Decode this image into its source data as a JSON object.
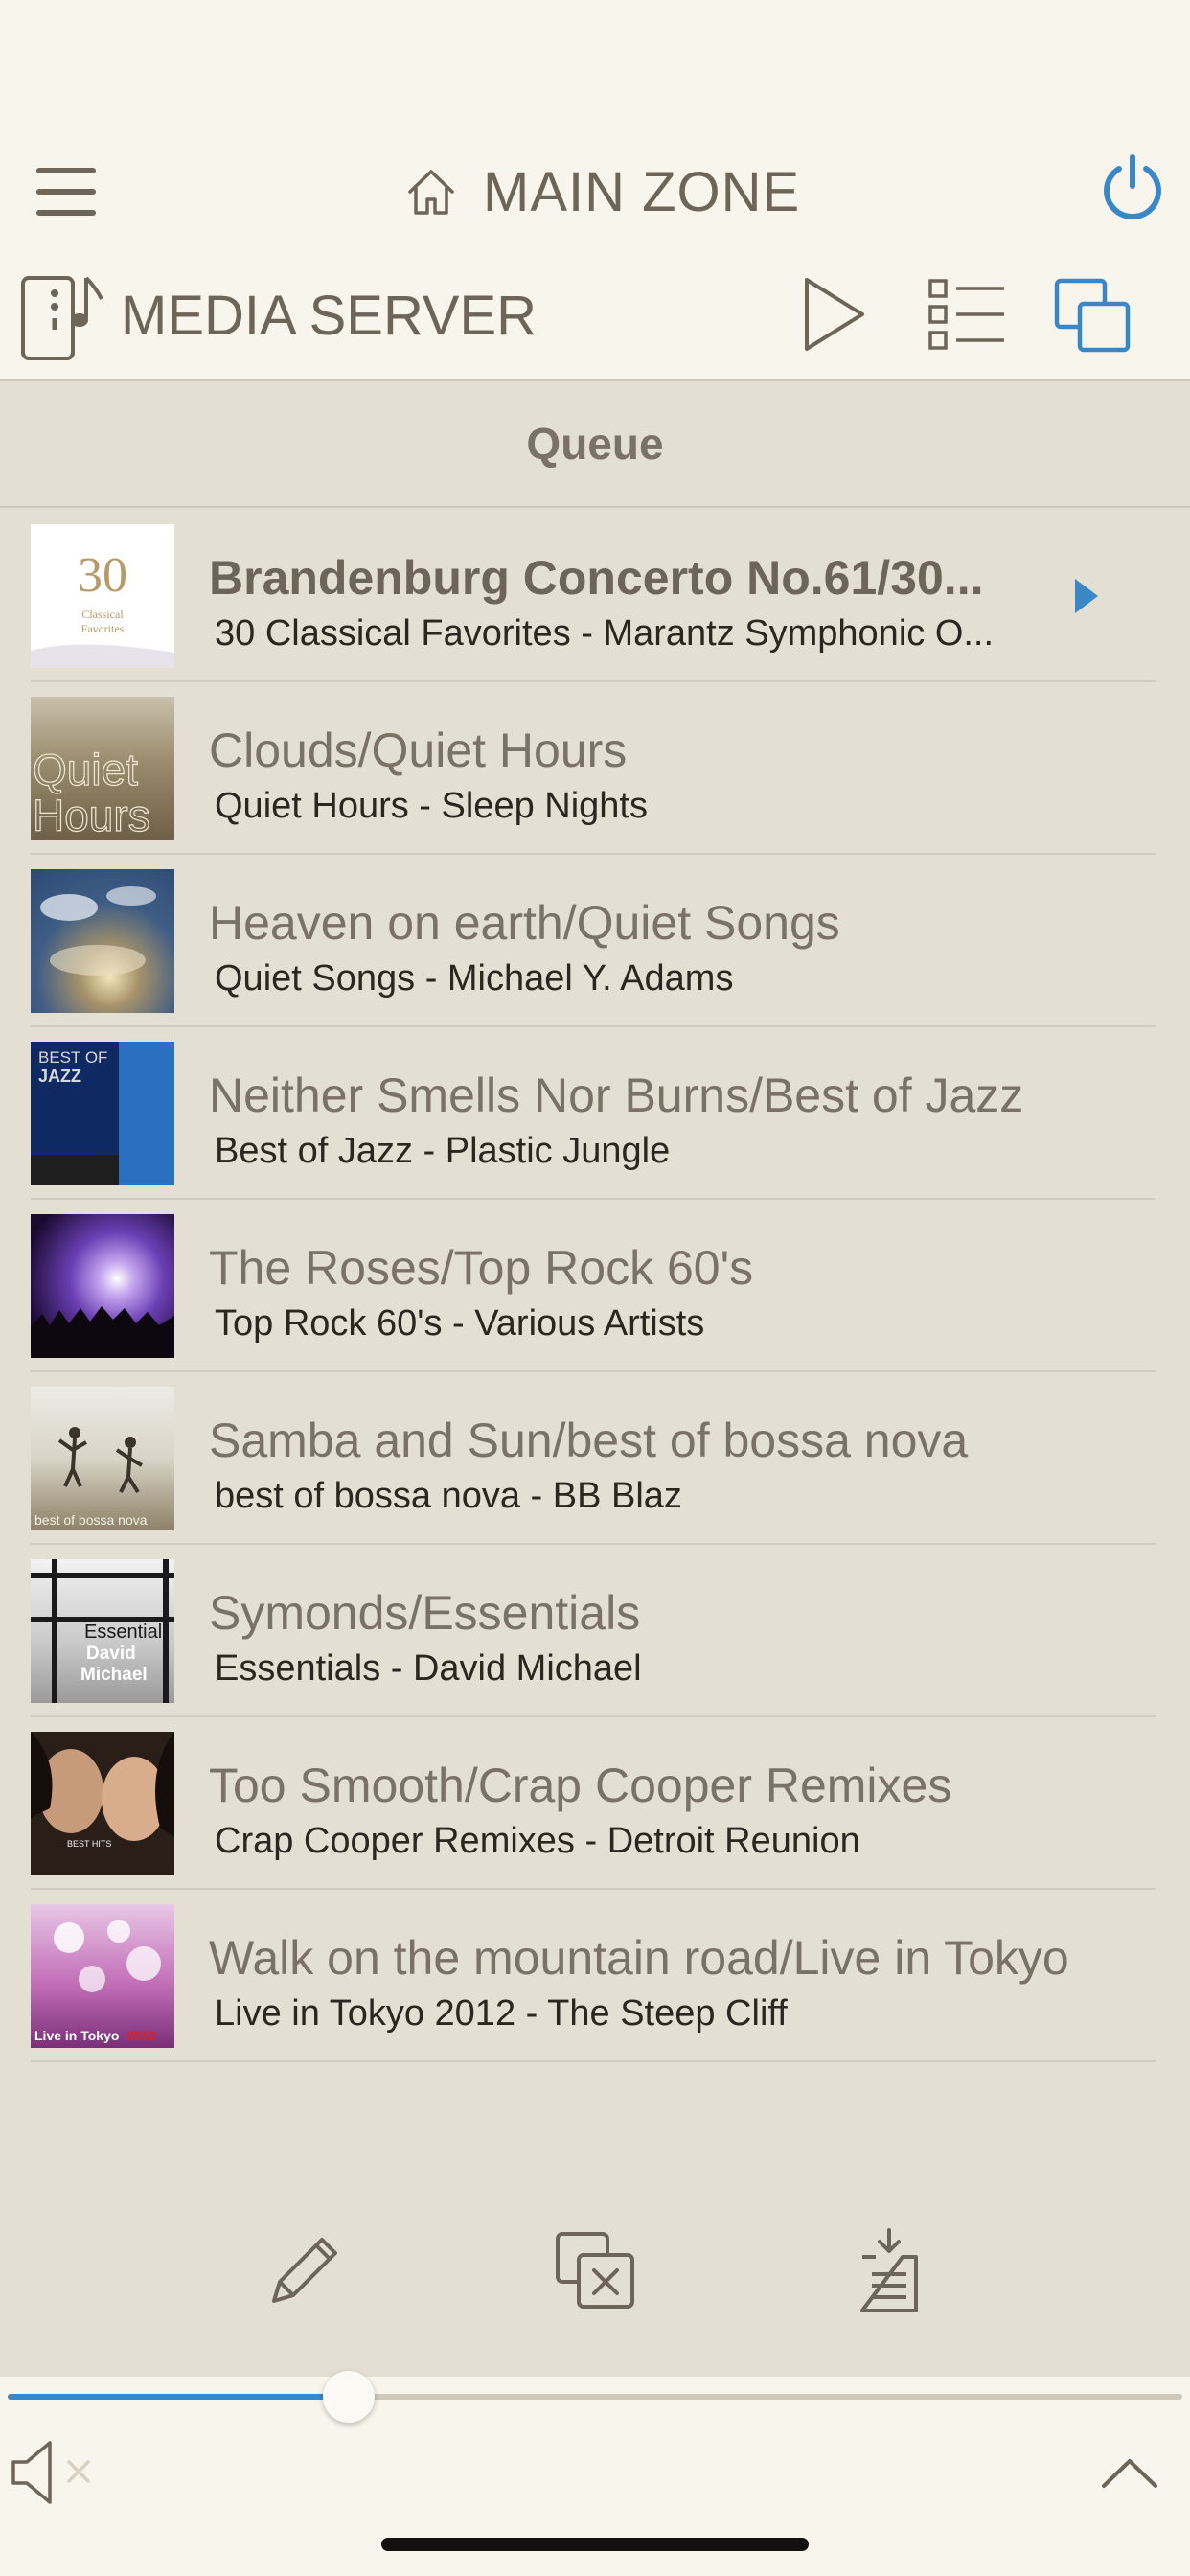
{
  "header": {
    "zone_title": "MAIN ZONE",
    "source_title": "MEDIA SERVER"
  },
  "queue": {
    "title": "Queue",
    "tracks": [
      {
        "title": "Brandenburg Concerto No.61/30...",
        "subtitle": "30 Classical Favorites - Marantz Symphonic O...",
        "art_number": "30",
        "art_line1": "Classical",
        "art_line2": "Favorites",
        "current": true
      },
      {
        "title": "Clouds/Quiet Hours",
        "subtitle": "Quiet Hours - Sleep Nights",
        "art_line1": "Quiet",
        "art_line2": "Hours"
      },
      {
        "title": "Heaven on earth/Quiet Songs",
        "subtitle": "Quiet Songs - Michael Y. Adams"
      },
      {
        "title": "Neither Smells Nor Burns/Best of Jazz",
        "subtitle": "Best of Jazz - Plastic Jungle",
        "art_line1": "BEST OF",
        "art_line2": "JAZZ"
      },
      {
        "title": "The Roses/Top Rock 60's",
        "subtitle": "Top Rock 60's - Various Artists"
      },
      {
        "title": "Samba and Sun/best of bossa nova",
        "subtitle": "best of bossa nova - BB Blaz",
        "art_line1": "best of bossa nova"
      },
      {
        "title": "Symonds/Essentials",
        "subtitle": "Essentials - David Michael",
        "art_line1": "Essential",
        "art_line2": "David",
        "art_line3": "Michael"
      },
      {
        "title": "Too Smooth/Crap Cooper Remixes",
        "subtitle": "Crap Cooper Remixes - Detroit Reunion",
        "art_line1": "BEST HITS"
      },
      {
        "title": "Walk on the mountain road/Live in Tokyo...",
        "subtitle": "Live in Tokyo 2012 - The Steep Cliff",
        "art_line1": "Live in Tokyo",
        "art_line2": "2012"
      }
    ]
  },
  "volume": {
    "level": 0.29
  },
  "colors": {
    "accent": "#3a87c8",
    "background": "#f8f5ec",
    "list_background": "#e4dfd3",
    "text": "#6d6558"
  },
  "icons": [
    "menu-icon",
    "home-icon",
    "power-icon",
    "media-server-icon",
    "play-icon",
    "list-icon",
    "zones-icon",
    "pencil-icon",
    "clear-queue-icon",
    "save-queue-icon",
    "mute-icon",
    "chevron-up-icon"
  ]
}
